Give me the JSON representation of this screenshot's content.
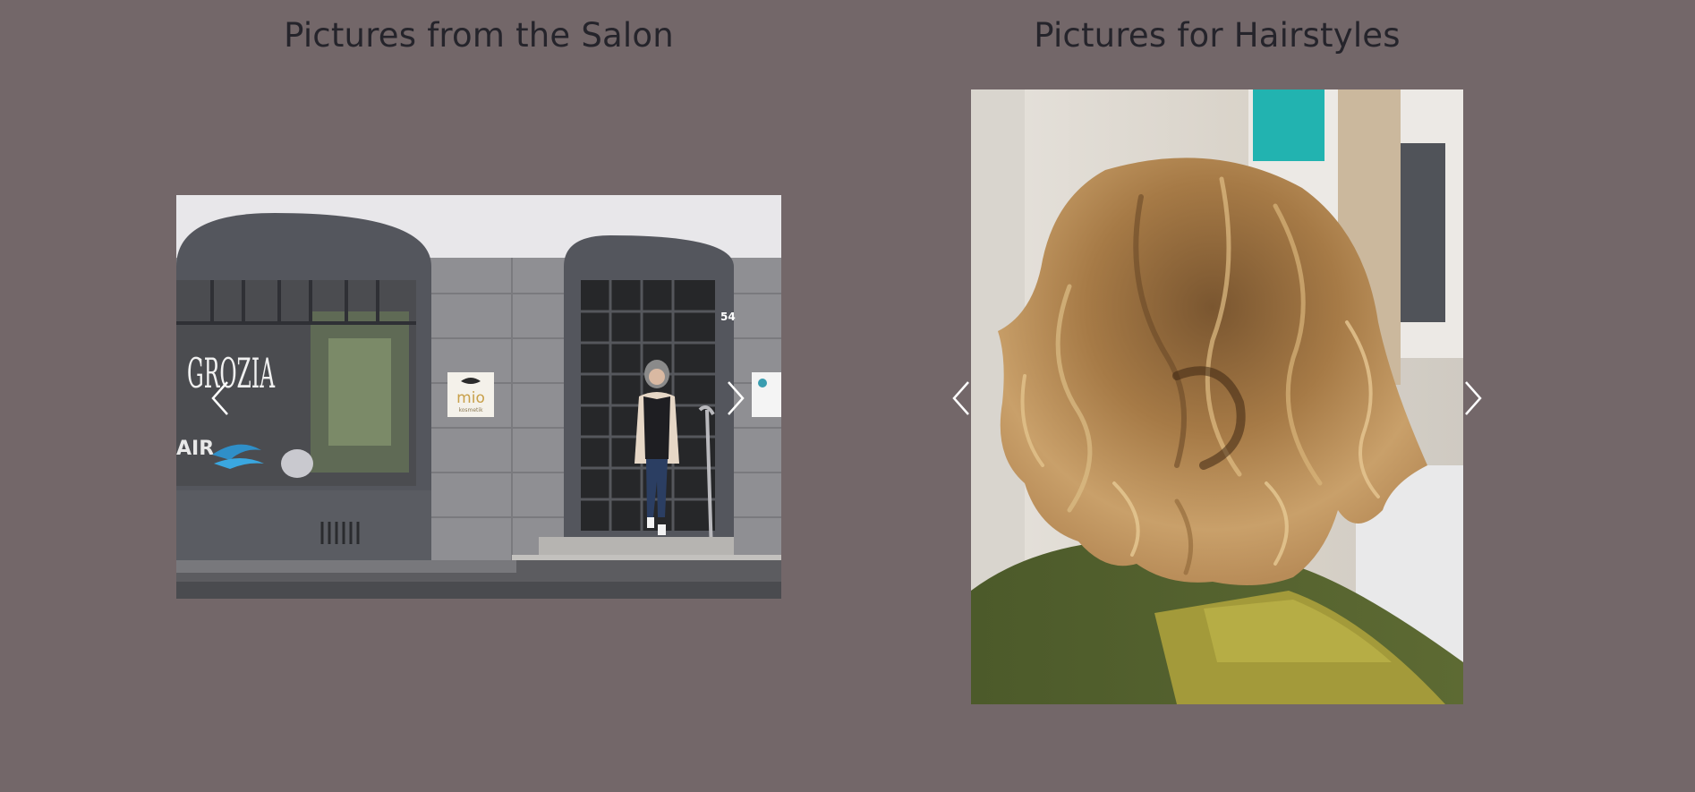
{
  "salon": {
    "title": "Pictures from the Salon",
    "image_alt": "Salon storefront with woman stepping out of the entrance",
    "storefront": {
      "window_sign": "GROZIA",
      "window_sign_2": "AIR",
      "plaque_brand": "mio",
      "plaque_sub": "kosmetik",
      "house_number": "54"
    },
    "prev_icon": "chevron-left-icon",
    "next_icon": "chevron-right-icon"
  },
  "hairstyles": {
    "title": "Pictures for Hairstyles",
    "image_alt": "Back view of a wavy balayage bob hairstyle",
    "prev_icon": "chevron-left-icon",
    "next_icon": "chevron-right-icon"
  },
  "colors": {
    "background": "#736769",
    "title": "#25242b",
    "arrow": "#ffffff"
  }
}
